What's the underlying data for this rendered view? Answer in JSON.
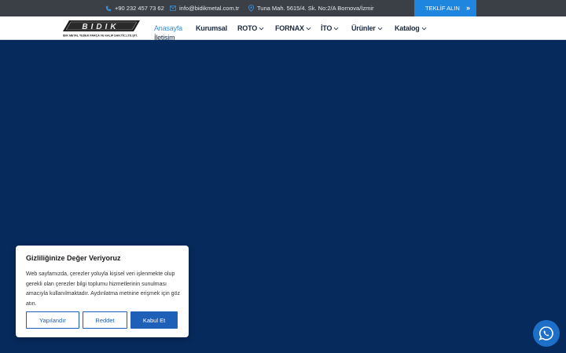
{
  "topbar": {
    "phone": "+90 232 457 73 62",
    "email": "info@bidikmetal.com.tr",
    "address": "Tuna Mah. 5615/4. Sk. No:2/A Bornova/İzmir",
    "cta_label": "TEKLİF ALIN",
    "cta_arrows": "»"
  },
  "logo": {
    "brand": "BIDIK",
    "tagline": "BIDIK METAL YEDEK PARÇA VE KALIP SAN.TİC.LTD.ŞTİ."
  },
  "nav": {
    "items": [
      {
        "label": "Anasayfa"
      },
      {
        "label": "Kurumsal"
      },
      {
        "label": "ROTO"
      },
      {
        "label": "FORNAX"
      },
      {
        "label": "İTO"
      },
      {
        "label": "Ürünler"
      },
      {
        "label": "Katalog"
      },
      {
        "label": "İletişim"
      }
    ]
  },
  "cookie": {
    "title": "Gizliliğinize Değer Veriyoruz",
    "text": "Web sayfamızda, çerezler yoluyla kişisel veri işlenmekte olup gerekli olan çerezler bilgi toplumu hizmetlerinin sunulması amacıyla kullanılmaktadır. Aydınlatma metnine erişmek için göz atın.",
    "customize_label": "Yapılandır",
    "reject_label": "Reddet",
    "accept_label": "Kabul Et"
  },
  "colors": {
    "topbar": "#3b4047",
    "cta": "#1f86e0",
    "hero": "#062a5c",
    "nav_active": "#3d8fd4",
    "accept_button": "#1e5fb8"
  },
  "icons": {
    "phone": "phone-icon",
    "email": "envelope-icon",
    "address": "map-pin-icon",
    "whatsapp": "whatsapp-icon"
  }
}
